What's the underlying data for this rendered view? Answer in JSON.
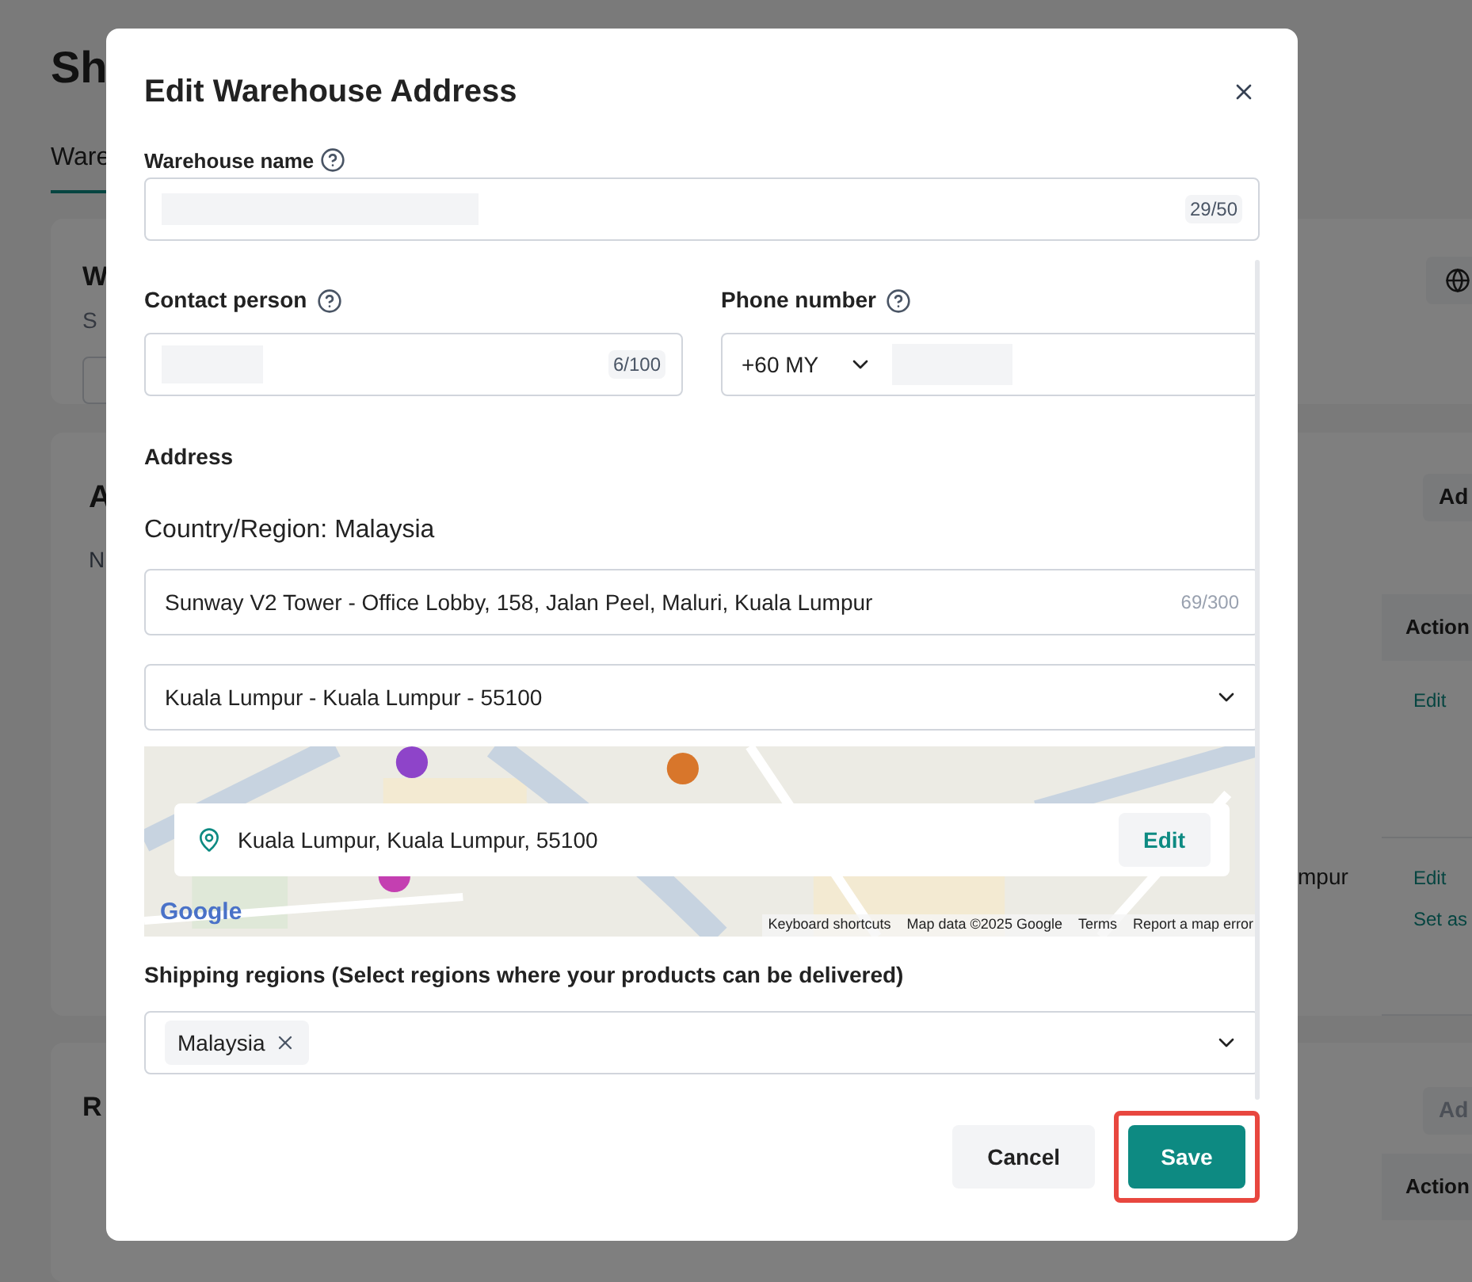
{
  "page": {
    "title": "Sh",
    "tab": "Ware",
    "section_1": {
      "title": "W",
      "subtitle": "S"
    },
    "section_2": {
      "title": "A",
      "note": "N",
      "add_button": "Ad",
      "action_header": "Action",
      "rows": [
        {
          "address": "",
          "actions": [
            "Edit"
          ]
        },
        {
          "address": "mpur",
          "actions": [
            "Edit",
            "Set as"
          ]
        }
      ]
    },
    "section_3": {
      "title": "R",
      "add_button": "Ad",
      "add_disabled": true,
      "action_header": "Action"
    }
  },
  "dialog": {
    "title": "Edit Warehouse Address",
    "warehouse_name": {
      "label": "Warehouse name",
      "counter": "29/50"
    },
    "contact_person": {
      "label": "Contact person",
      "counter": "6/100"
    },
    "phone_number": {
      "label": "Phone number",
      "country_code": "+60 MY"
    },
    "address": {
      "label": "Address",
      "country": "Country/Region: Malaysia",
      "street": "Sunway V2 Tower - Office Lobby, 158, Jalan Peel, Maluri, Kuala Lumpur",
      "street_counter": "69/300",
      "area": "Kuala Lumpur - Kuala Lumpur - 55100",
      "map": {
        "kind": "picture",
        "location": "Kuala Lumpur, Kuala Lumpur, 55100",
        "edit": "Edit",
        "logo": "Google",
        "attribution": [
          "Keyboard shortcuts",
          "Map data ©2025 Google",
          "Terms",
          "Report a map error"
        ]
      }
    },
    "shipping_regions": {
      "label": "Shipping regions (Select regions where your products can be delivered)",
      "tags": [
        "Malaysia"
      ]
    },
    "buttons": {
      "cancel": "Cancel",
      "save": "Save"
    },
    "save_highlighted": true
  }
}
